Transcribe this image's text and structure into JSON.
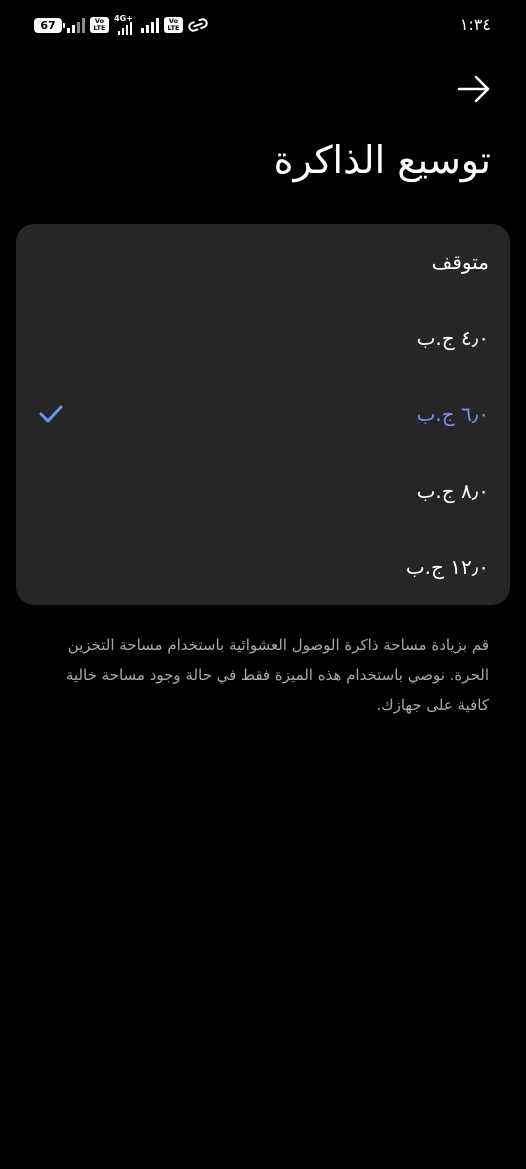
{
  "status_bar": {
    "battery": "67",
    "volte_top": "Vo",
    "volte_bottom": "LTE",
    "network": "4G+",
    "time": "١:٣٤"
  },
  "header": {
    "back_icon": "arrow-right-icon",
    "title": "توسيع الذاكرة"
  },
  "options": [
    {
      "label": "متوقف",
      "selected": false
    },
    {
      "label": "٤٫٠ ج.ب",
      "selected": false
    },
    {
      "label": "٦٫٠ ج.ب",
      "selected": true
    },
    {
      "label": "٨٫٠ ج.ب",
      "selected": false
    },
    {
      "label": "١٢٫٠ ج.ب",
      "selected": false
    }
  ],
  "description": "قم بزيادة مساحة ذاكرة الوصول العشوائية باستخدام مساحة التخزين الحرة. نوصي باستخدام هذه الميزة فقط في حالة وجود مساحة خالية كافية على جهازك.",
  "colors": {
    "background": "#000000",
    "card": "#262626",
    "accent": "#6f94f0",
    "text": "#ffffff",
    "secondary_text": "#a9a9a9"
  },
  "icons": {
    "check": "checkmark-icon",
    "link": "link-icon"
  }
}
